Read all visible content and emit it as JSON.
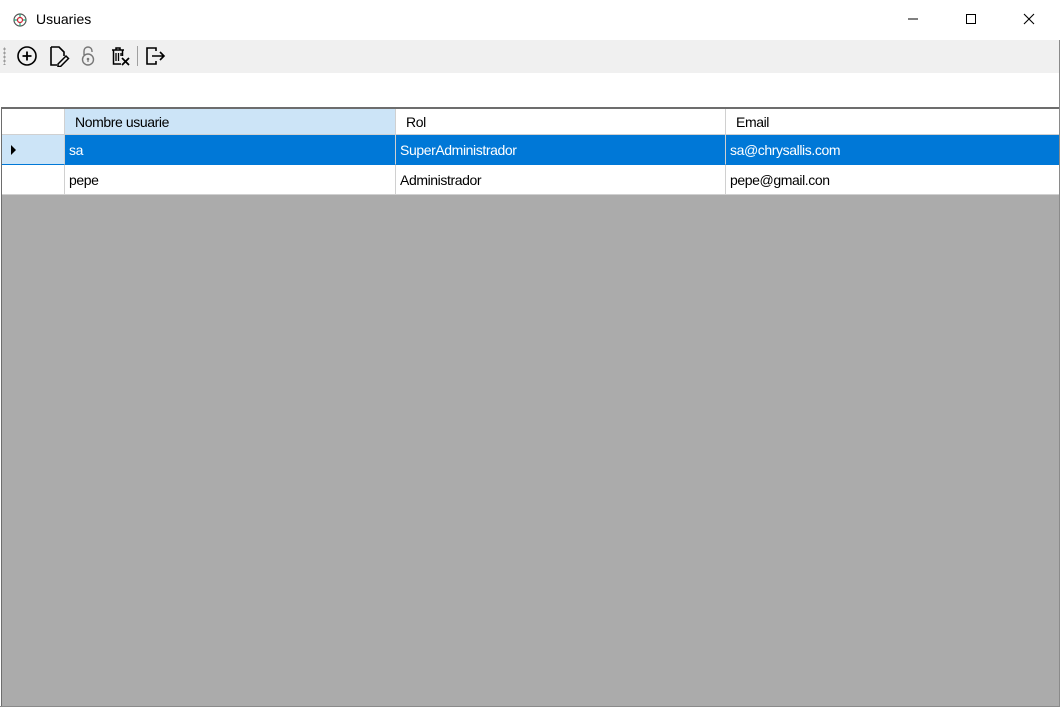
{
  "window": {
    "title": "Usuaries",
    "icon": "app-logo-icon",
    "controls": [
      "minimize-icon",
      "maximize-icon",
      "close-icon"
    ]
  },
  "toolbar": {
    "buttons": [
      {
        "name": "add-button",
        "icon": "add-circle-icon"
      },
      {
        "name": "edit-button",
        "icon": "edit-document-icon"
      },
      {
        "name": "reset-password-button",
        "icon": "unlock-icon"
      },
      {
        "name": "delete-button",
        "icon": "delete-icon"
      },
      {
        "name": "exit-button",
        "icon": "exit-icon"
      }
    ]
  },
  "grid": {
    "columns": [
      "Nombre usuarie",
      "Rol",
      "Email"
    ],
    "rows": [
      {
        "name": "sa",
        "rol": "SuperAdministrador",
        "email": "sa@chrysallis.com",
        "selected": true
      },
      {
        "name": "pepe",
        "rol": "Administrador",
        "email": "pepe@gmail.con",
        "selected": false
      }
    ],
    "colors": {
      "selection": "#0078d7",
      "header_highlight": "#cce4f7",
      "background": "#ababab"
    }
  }
}
